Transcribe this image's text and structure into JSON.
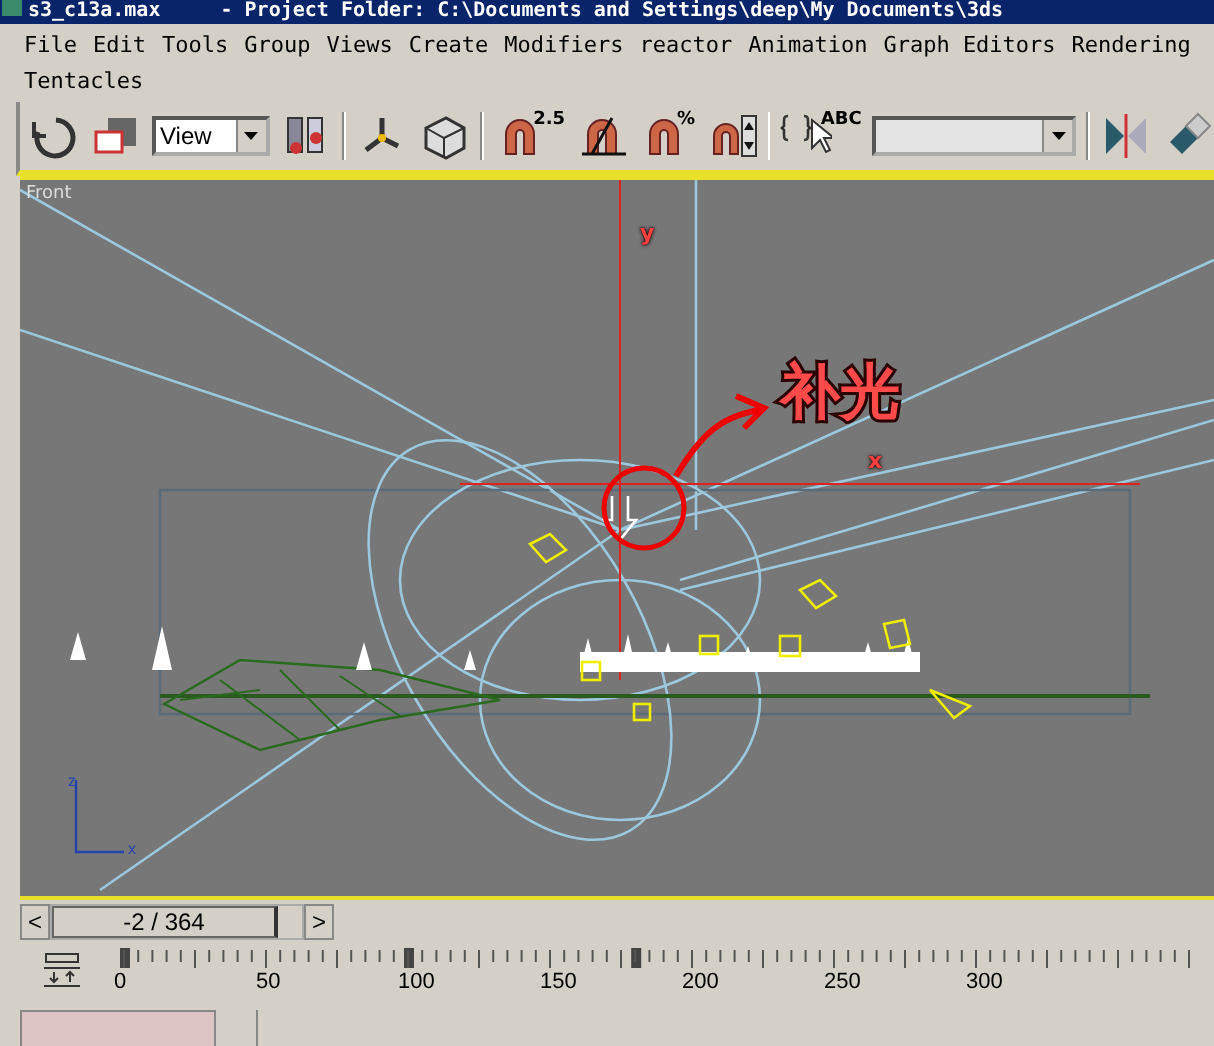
{
  "window": {
    "file_name": "s3_c13a.max",
    "title": "- Project Folder: C:\\Documents and Settings\\deep\\My Documents\\3ds"
  },
  "menu_rows": [
    [
      "File",
      "Edit",
      "Tools",
      "Group",
      "Views",
      "Create",
      "Modifiers",
      "reactor",
      "Animation",
      "Graph Editors",
      "Rendering"
    ],
    [
      "Tentacles"
    ]
  ],
  "toolbar": [
    {
      "kind": "icon"
    },
    {
      "kind": "icon"
    },
    {
      "kind": "dropdown",
      "value": "View"
    },
    {
      "kind": "icon"
    },
    {
      "kind": "sep"
    },
    {
      "kind": "icon"
    },
    {
      "kind": "icon"
    },
    {
      "kind": "sep"
    },
    {
      "kind": "icon",
      "label": "2.5"
    },
    {
      "kind": "icon"
    },
    {
      "kind": "icon",
      "label": "%"
    },
    {
      "kind": "icon"
    },
    {
      "kind": "sep"
    },
    {
      "kind": "icon",
      "label": "ABC"
    },
    {
      "kind": "dropdown"
    },
    {
      "kind": "sep"
    },
    {
      "kind": "icon"
    },
    {
      "kind": "icon"
    }
  ],
  "viewport": {
    "label": "Front",
    "axis_y": "y",
    "axis_x": "x",
    "annotation": "补光",
    "gizmo_z": "z",
    "gizmo_x": "x"
  },
  "time_slider": {
    "prev": "<",
    "value": "-2 / 364",
    "next": ">"
  },
  "ruler": {
    "labels": [
      "0",
      "50",
      "100",
      "150",
      "200",
      "250",
      "300"
    ]
  }
}
